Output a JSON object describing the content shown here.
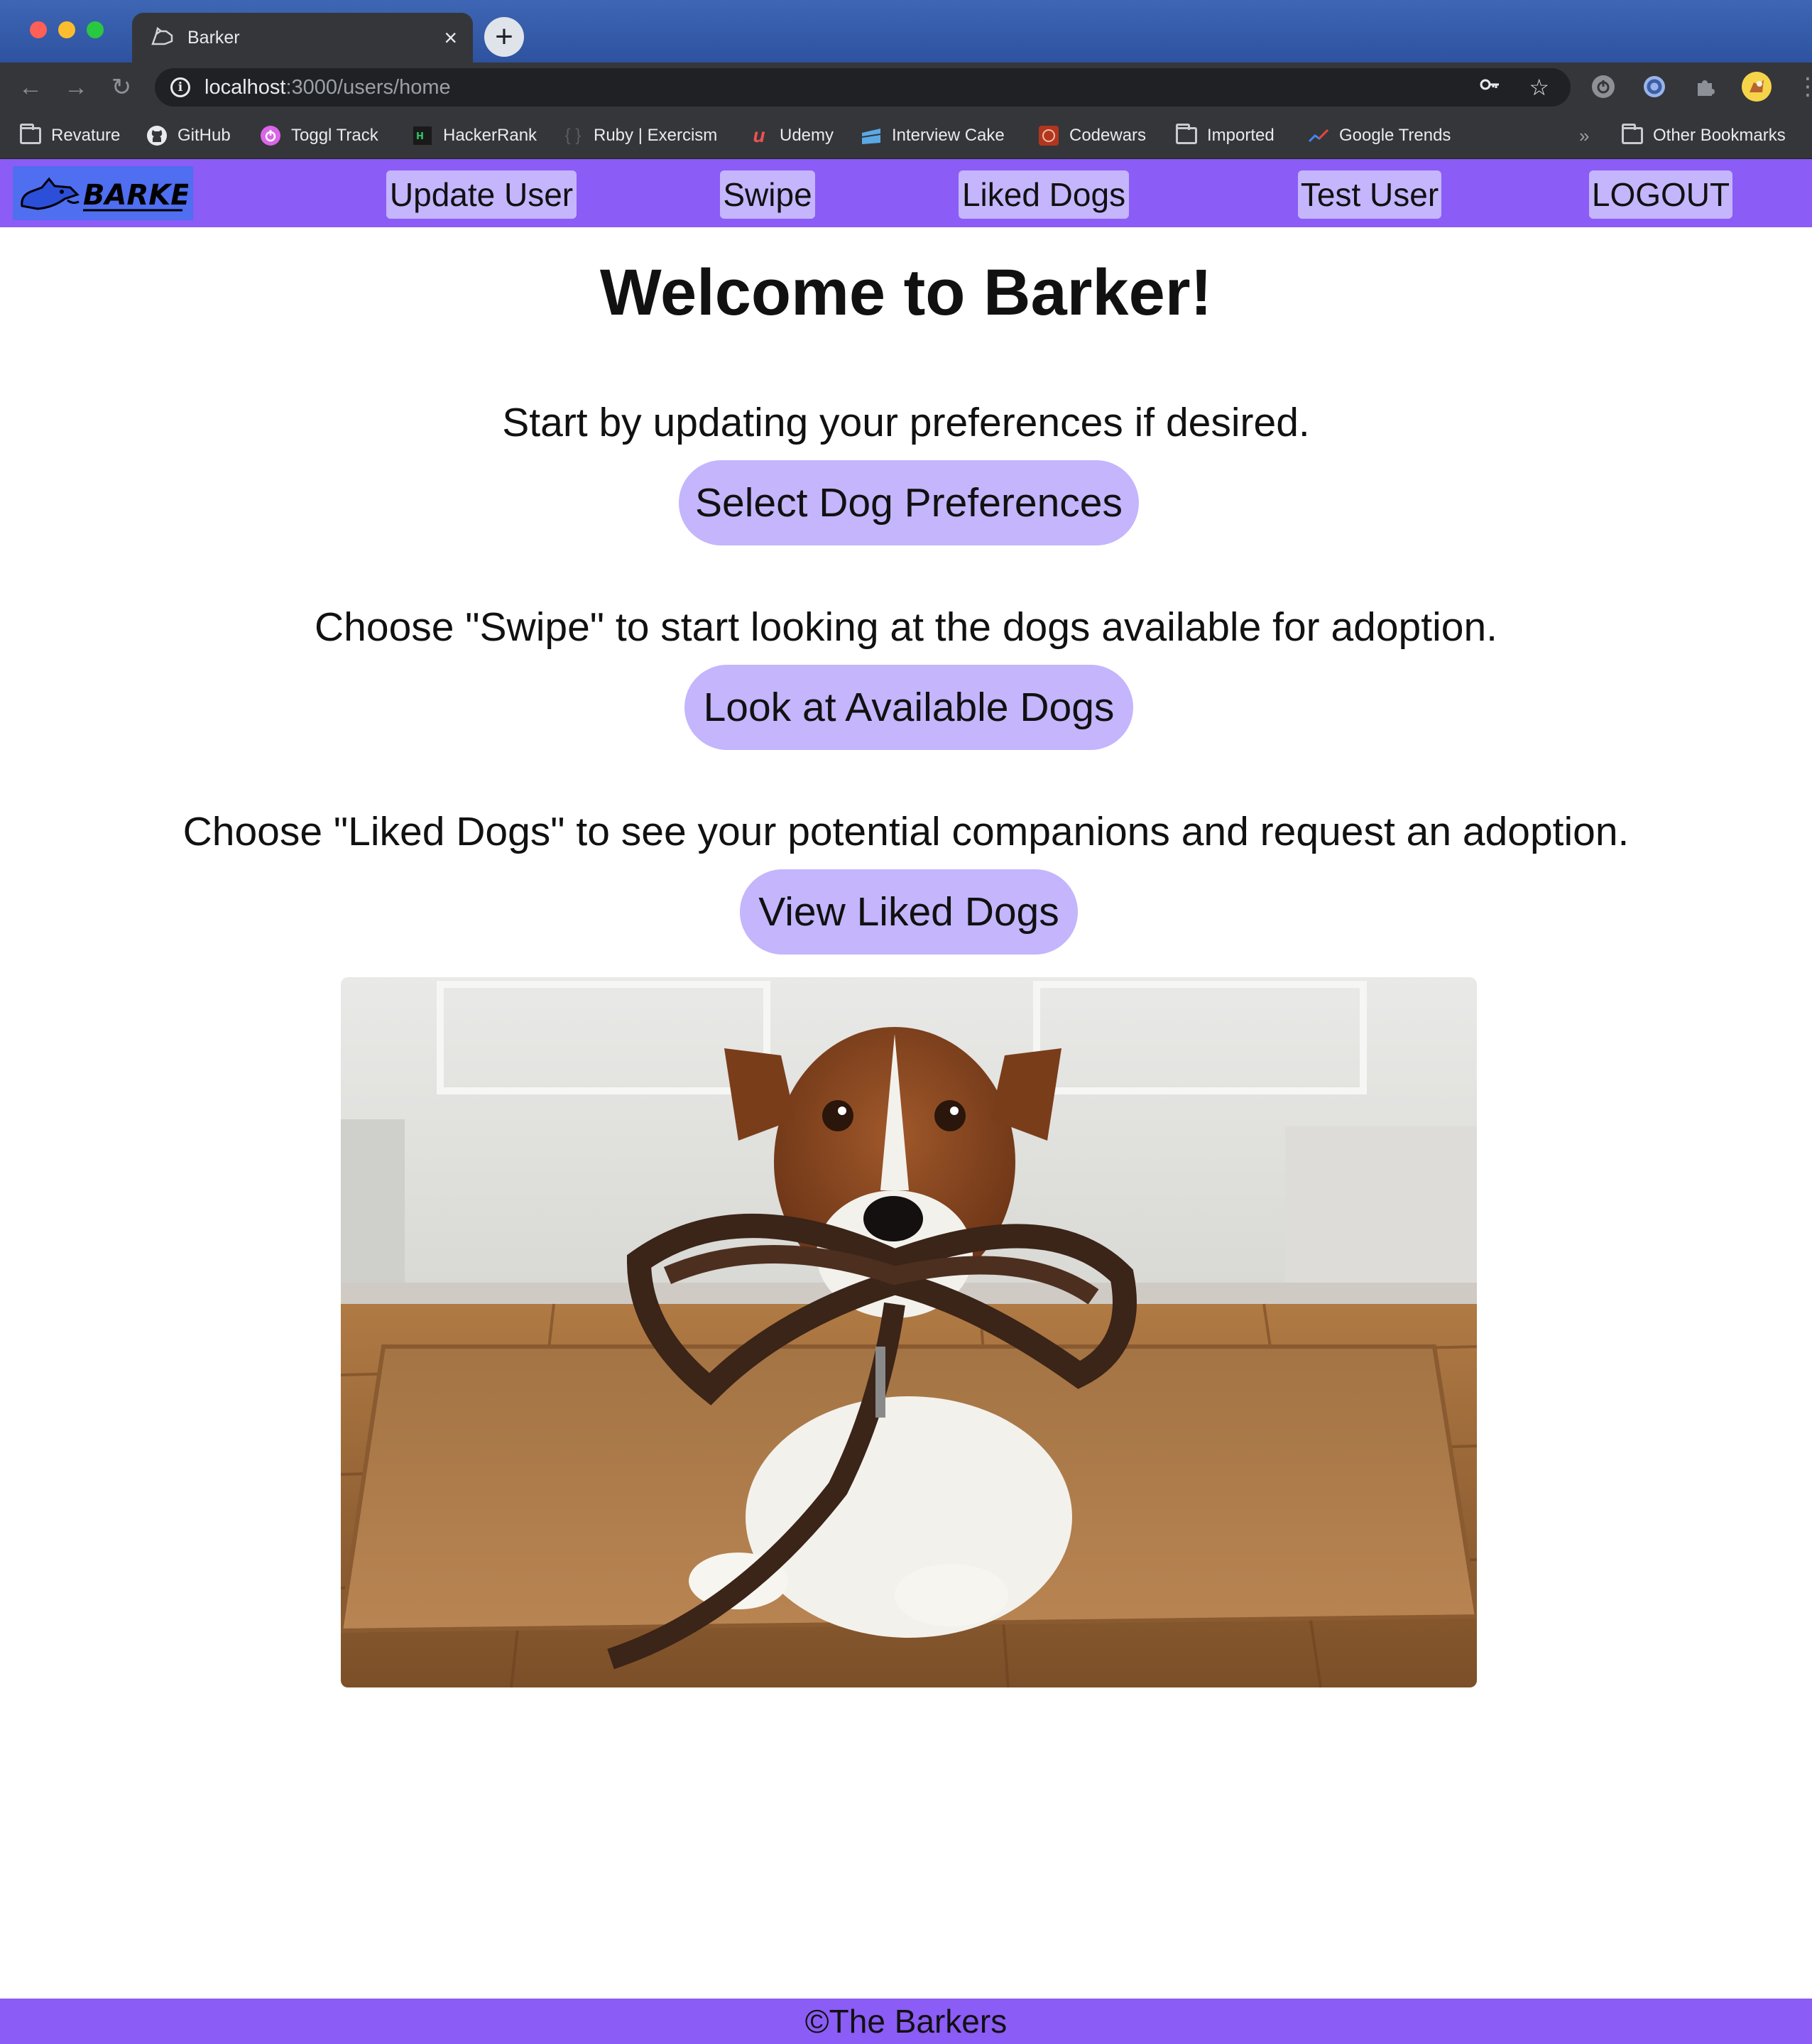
{
  "browser": {
    "tab_title": "Barker",
    "tab_close": "×",
    "new_tab": "+",
    "url_host": "localhost",
    "url_path": ":3000/users/home",
    "bookmarks": [
      {
        "label": "Revature",
        "icon": "folder-icon"
      },
      {
        "label": "GitHub",
        "icon": "github-icon"
      },
      {
        "label": "Toggl Track",
        "icon": "toggl-icon"
      },
      {
        "label": "HackerRank",
        "icon": "hackerrank-icon"
      },
      {
        "label": "Ruby | Exercism",
        "icon": "exercism-icon"
      },
      {
        "label": "Udemy",
        "icon": "udemy-icon"
      },
      {
        "label": "Interview Cake",
        "icon": "interview-cake-icon"
      },
      {
        "label": "Codewars",
        "icon": "codewars-icon"
      },
      {
        "label": "Imported",
        "icon": "folder-icon"
      },
      {
        "label": "Google Trends",
        "icon": "google-trends-icon"
      }
    ],
    "more_bookmarks": "»",
    "other_bookmarks": "Other Bookmarks"
  },
  "nav": {
    "logo_alt": "BARKER",
    "items": [
      "Update User",
      "Swipe",
      "Liked Dogs",
      "Test User",
      "LOGOUT"
    ]
  },
  "main": {
    "title": "Welcome to Barker!",
    "sections": [
      {
        "text": "Start by updating your preferences if desired.",
        "button": "Select Dog Preferences"
      },
      {
        "text": "Choose \"Swipe\" to start looking at the dogs available for adoption.",
        "button": "Look at Available Dogs"
      },
      {
        "text": "Choose \"Liked Dogs\" to see your potential companions and request an adoption.",
        "button": "View Liked Dogs"
      }
    ],
    "image_subject": "dog holding leash on doormat"
  },
  "footer": {
    "text": "©The Barkers"
  },
  "colors": {
    "nav_bg": "#8b5cf6",
    "button_bg": "#c4b5fd",
    "logo_bg": "#4f6ef0"
  }
}
